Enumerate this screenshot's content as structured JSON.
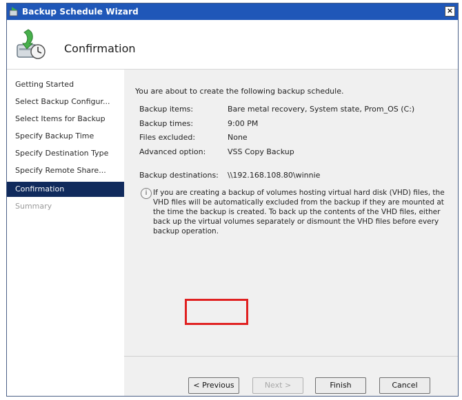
{
  "window": {
    "title": "Backup Schedule Wizard",
    "close_label": "×"
  },
  "header": {
    "title": "Confirmation",
    "icon": "backup-wizard-icon"
  },
  "nav": {
    "items": [
      {
        "label": "Getting Started",
        "state": "normal"
      },
      {
        "label": "Select Backup Configur...",
        "state": "normal"
      },
      {
        "label": "Select Items for Backup",
        "state": "normal"
      },
      {
        "label": "Specify Backup Time",
        "state": "normal"
      },
      {
        "label": "Specify Destination Type",
        "state": "normal"
      },
      {
        "label": "Specify Remote Share...",
        "state": "normal"
      },
      {
        "label": "Confirmation",
        "state": "active"
      },
      {
        "label": "Summary",
        "state": "disabled"
      }
    ]
  },
  "content": {
    "intro": "You are about to create the following backup schedule.",
    "details": [
      {
        "label": "Backup items:",
        "value": "Bare metal recovery, System state, Prom_OS (C:)"
      },
      {
        "label": "Backup times:",
        "value": "9:00 PM"
      },
      {
        "label": "Files excluded:",
        "value": "None"
      },
      {
        "label": "Advanced option:",
        "value": "VSS Copy Backup"
      }
    ],
    "destination": {
      "label": "Backup destinations:",
      "value": "\\\\192.168.108.80\\winnie"
    },
    "note": "If you are creating a backup of volumes hosting virtual hard disk (VHD) files, the VHD files will be automatically excluded from the backup if they are mounted at the time the backup is created. To back up the contents of the VHD files, either back up the virtual volumes separately or dismount the VHD files before every backup operation.",
    "note_icon": "info-icon"
  },
  "buttons": {
    "previous": "< Previous",
    "next": "Next >",
    "finish": "Finish",
    "cancel": "Cancel"
  },
  "colors": {
    "title_bar": "#1f57b8",
    "active_nav": "#102a5c",
    "highlight": "#e02020"
  }
}
